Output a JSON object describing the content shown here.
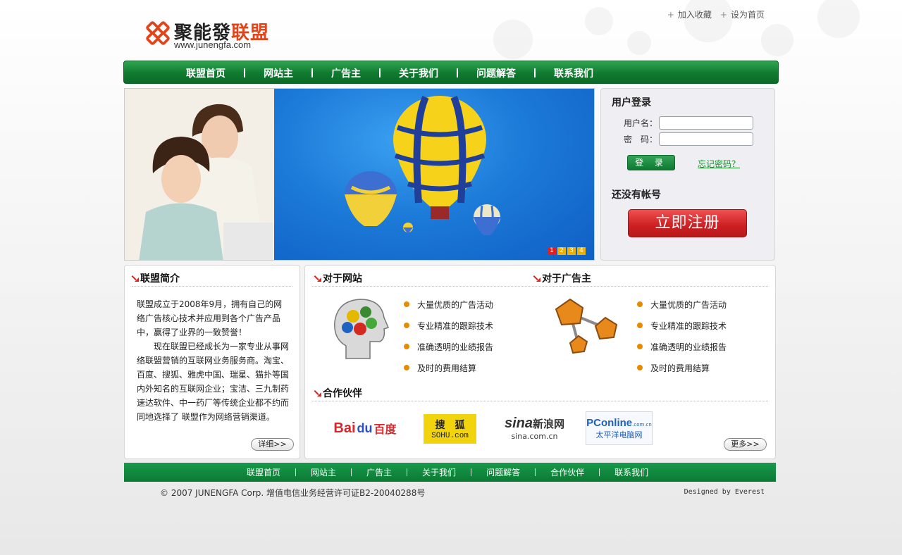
{
  "header": {
    "logo_text_a": "聚能發",
    "logo_text_b": "联盟",
    "logo_url": "www.junengfa.com",
    "top_links": [
      "加入收藏",
      "设为首页"
    ]
  },
  "nav": {
    "items": [
      "联盟首页",
      "网站主",
      "广告主",
      "关于我们",
      "问题解答",
      "联系我们"
    ]
  },
  "banner": {
    "dots": [
      "1",
      "2",
      "3",
      "4"
    ],
    "active_dot": 1
  },
  "login": {
    "title": "用户登录",
    "username_label": "用户名：",
    "password_label": "密　码：",
    "username_value": "",
    "password_value": "",
    "login_button": "登 录",
    "forgot_link": "忘记密码？",
    "no_account": "还没有帐号",
    "register_button": "立即注册"
  },
  "intro": {
    "title": "联盟简介",
    "paragraph1": "联盟成立于2008年9月，拥有自己的网络广告核心技术并应用到各个广告产品中，赢得了业界的一致赞誉！",
    "paragraph2": "现在联盟已经成长为一家专业从事网络联盟营销的互联网业务服务商。淘宝、百度、搜狐、雅虎中国、瑞星、猫扑等国内外知名的互联网企业；宝洁、三九制药速达软件、中一药厂等传统企业都不约而同地选择了 联盟作为网络营销渠道。",
    "more_button": "详细>>"
  },
  "features": {
    "site_title": "对于网站",
    "advertiser_title": "对于广告主",
    "site_items": [
      "大量优质的广告活动",
      "专业精准的跟踪技术",
      "准确透明的业绩报告",
      "及时的费用结算"
    ],
    "advertiser_items": [
      "大量优质的广告活动",
      "专业精准的跟踪技术",
      "准确透明的业绩报告",
      "及时的费用结算"
    ],
    "partners_title": "合作伙伴",
    "partners": {
      "baidu_a": "Bai",
      "baidu_b": "du",
      "baidu_c": "百度",
      "sohu_a": "搜　狐",
      "sohu_b": "SOHU.com",
      "sina_a": "sina",
      "sina_b": "新浪网",
      "sina_c": "sina.com.cn",
      "pconline_a": "PConline",
      "pconline_b": ".com.cn",
      "pconline_c": "太平洋电脑网"
    },
    "more_button": "更多>>"
  },
  "footer": {
    "nav": [
      "联盟首页",
      "网站主",
      "广告主",
      "关于我们",
      "问题解答",
      "合作伙伴",
      "联系我们"
    ],
    "copyright": "© 2007 JUNENGFA Corp. 增值电信业务经营许可证B2-20040288号",
    "designed_by": "Designed by Everest"
  },
  "colors": {
    "nav_green": "#0f7a30",
    "register_red": "#cc1f22",
    "bullet_orange": "#e88a00",
    "logo_orange": "#e0451b"
  }
}
